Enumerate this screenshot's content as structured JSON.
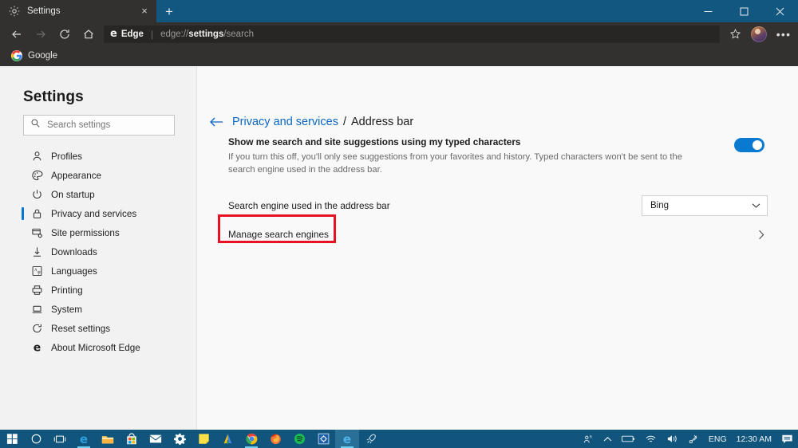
{
  "window": {
    "tab": {
      "title": "Settings",
      "icon": "gear-icon",
      "close_label": "×"
    },
    "newtab_label": "+",
    "controls": {
      "minimize": "minimize-icon",
      "maximize": "maximize-icon",
      "close": "close-icon"
    }
  },
  "toolbar": {
    "back": "back-arrow-icon",
    "forward": "forward-arrow-icon",
    "refresh": "refresh-icon",
    "home": "home-icon",
    "brand_logo": "e",
    "brand_label": "Edge",
    "separator": "|",
    "url_scheme": "edge://",
    "url_bold": "settings",
    "url_rest": "/search",
    "url_full": "edge://settings/search",
    "favorite": "star-icon",
    "profile": "avatar",
    "more_label": "•••"
  },
  "bookmarks": {
    "items": [
      {
        "label": "Google",
        "icon": "google-icon"
      }
    ]
  },
  "sidebar": {
    "title": "Settings",
    "search": {
      "placeholder": "Search settings",
      "value": "",
      "icon": "search-icon"
    },
    "items": [
      {
        "label": "Profiles",
        "icon": "person-icon",
        "active": false
      },
      {
        "label": "Appearance",
        "icon": "palette-icon",
        "active": false
      },
      {
        "label": "On startup",
        "icon": "power-icon",
        "active": false
      },
      {
        "label": "Privacy and services",
        "icon": "lock-icon",
        "active": true
      },
      {
        "label": "Site permissions",
        "icon": "site-permissions-icon",
        "active": false
      },
      {
        "label": "Downloads",
        "icon": "download-arrow-icon",
        "active": false
      },
      {
        "label": "Languages",
        "icon": "translate-icon",
        "active": false
      },
      {
        "label": "Printing",
        "icon": "printer-icon",
        "active": false
      },
      {
        "label": "System",
        "icon": "laptop-icon",
        "active": false
      },
      {
        "label": "Reset settings",
        "icon": "reset-icon",
        "active": false
      },
      {
        "label": "About Microsoft Edge",
        "icon": "edge-logo-icon",
        "active": false
      }
    ]
  },
  "content": {
    "breadcrumb": {
      "back_icon": "back-arrow-icon",
      "parent": "Privacy and services",
      "separator": "/",
      "current": "Address bar"
    },
    "suggestions_setting": {
      "title": "Show me search and site suggestions using my typed characters",
      "description": "If you turn this off, you'll only see suggestions from your favorites and history. Typed characters won't be sent to the search engine used in the address bar.",
      "toggle_state": "on"
    },
    "search_engine_setting": {
      "label": "Search engine used in the address bar",
      "selected": "Bing",
      "chevron": "chevron-down-icon"
    },
    "manage_search_engines": {
      "label": "Manage search engines",
      "chevron": "chevron-right-icon",
      "highlighted": true,
      "highlight_color": "#e81123"
    }
  },
  "taskbar": {
    "items": [
      {
        "name": "start-button",
        "icon": "windows-logo-icon"
      },
      {
        "name": "cortana-button",
        "icon": "circle-icon"
      },
      {
        "name": "task-view-button",
        "icon": "task-view-icon"
      },
      {
        "name": "taskbar-edge",
        "icon": "edge-logo-icon",
        "running": true
      },
      {
        "name": "taskbar-file-explorer",
        "icon": "folder-icon"
      },
      {
        "name": "taskbar-microsoft-store",
        "icon": "store-icon"
      },
      {
        "name": "taskbar-mail",
        "icon": "mail-icon"
      },
      {
        "name": "taskbar-settings",
        "icon": "gear-icon"
      },
      {
        "name": "taskbar-sticky-notes",
        "icon": "sticky-note-icon"
      },
      {
        "name": "taskbar-google-ads",
        "icon": "google-ads-icon"
      },
      {
        "name": "taskbar-chrome",
        "icon": "chrome-icon",
        "running": true
      },
      {
        "name": "taskbar-firefox",
        "icon": "firefox-icon"
      },
      {
        "name": "taskbar-spotify",
        "icon": "spotify-icon"
      },
      {
        "name": "taskbar-app-blue",
        "icon": "blue-app-icon"
      },
      {
        "name": "taskbar-edge-active",
        "icon": "edge-logo-icon",
        "active": true,
        "running": true
      },
      {
        "name": "taskbar-rocket",
        "icon": "rocket-icon"
      }
    ],
    "tray": {
      "people": "person-share-icon",
      "chevron": "chevron-up-icon",
      "battery": "battery-icon",
      "wifi": "wifi-icon",
      "volume": "volume-icon",
      "bluetooth": "bluetooth-icon",
      "language": "ENG",
      "clock": "12:30 AM",
      "notifications": "notification-icon"
    }
  },
  "colors": {
    "accent": "#0078d4",
    "titlebar": "#12577f",
    "toolbar": "#323130",
    "taskbar": "#11557c",
    "link": "#0a66c2",
    "annotation": "#e81123"
  }
}
